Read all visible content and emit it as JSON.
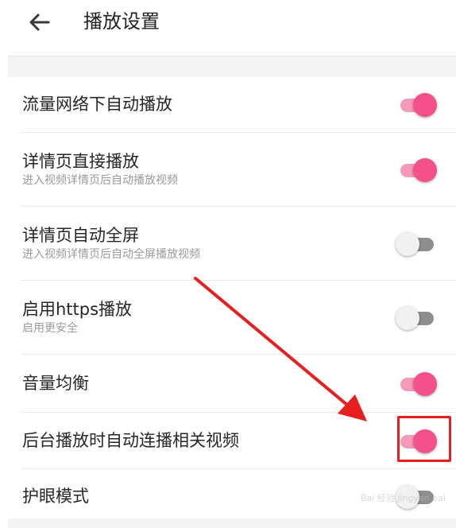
{
  "header": {
    "back_icon": "arrow-left-icon",
    "title": "播放设置"
  },
  "settings": [
    {
      "title": "流量网络下自动播放",
      "subtitle": "",
      "enabled": true
    },
    {
      "title": "详情页直接播放",
      "subtitle": "进入视频详情页后自动播放视频",
      "enabled": true
    },
    {
      "title": "详情页自动全屏",
      "subtitle": "进入视频详情页后自动全屏播放视频",
      "enabled": false
    },
    {
      "title": "启用https播放",
      "subtitle": "启用更安全",
      "enabled": false
    },
    {
      "title": "音量均衡",
      "subtitle": "",
      "enabled": true
    },
    {
      "title": "后台播放时自动连播相关视频",
      "subtitle": "",
      "enabled": true
    },
    {
      "title": "护眼模式",
      "subtitle": "",
      "enabled": false
    }
  ],
  "annotation": {
    "arrow_color": "#e81e1e",
    "box_color": "#e81e1e"
  },
  "colors": {
    "toggle_on_thumb": "#f4518a",
    "toggle_on_track": "#f59ab8",
    "toggle_off_thumb": "#f1f1f1",
    "toggle_off_track": "#8e8e8e"
  },
  "watermark_text": "Bai 经验 jingyan.baidu.com"
}
